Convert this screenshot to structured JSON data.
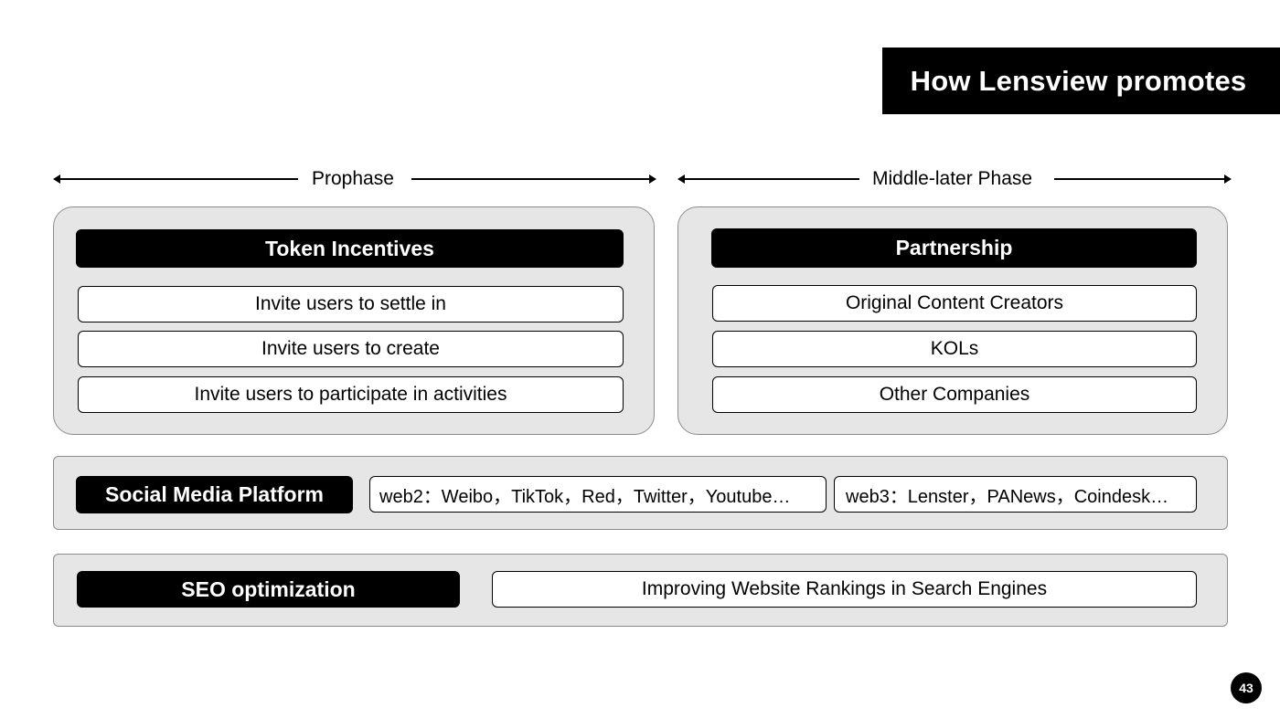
{
  "slide": {
    "title": "How Lensview promotes",
    "page_number": "43"
  },
  "phases": {
    "prophase": {
      "label": "Prophase"
    },
    "middle_later": {
      "label": "Middle-later Phase"
    }
  },
  "token_incentives": {
    "heading": "Token Incentives",
    "items": [
      "Invite users to settle in",
      "Invite users to create",
      "Invite users to participate in activities"
    ]
  },
  "partnership": {
    "heading": "Partnership",
    "items": [
      "Original Content Creators",
      "KOLs",
      "Other Companies"
    ]
  },
  "social_media": {
    "heading": "Social Media Platform",
    "web2": "web2：Weibo，TikTok，Red，Twitter，Youtube…",
    "web3": "web3：Lenster，PANews，Coindesk…"
  },
  "seo": {
    "heading": "SEO optimization",
    "description": "Improving Website Rankings in Search Engines"
  },
  "colors": {
    "panel_background": "#e6e6e6",
    "heading_background": "#000000",
    "heading_text": "#ffffff"
  }
}
